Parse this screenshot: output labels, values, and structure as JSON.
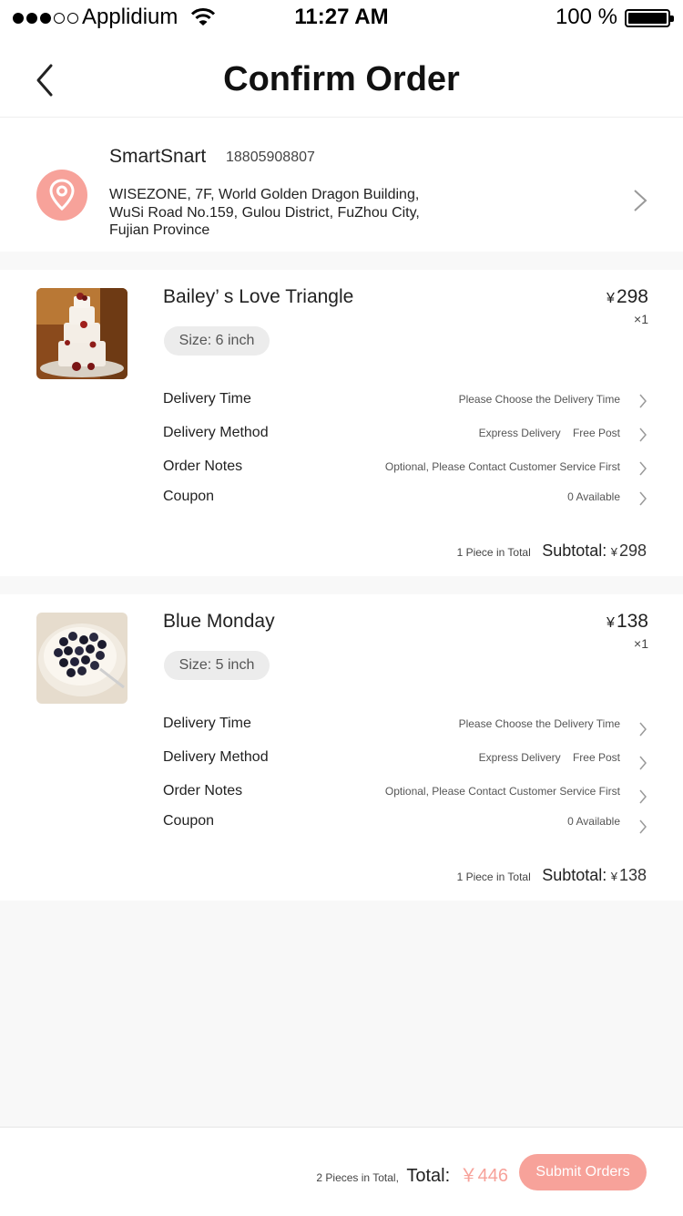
{
  "status_bar": {
    "carrier": "Applidium",
    "time": "11:27 AM",
    "battery": "100 %"
  },
  "nav": {
    "title": "Confirm Order",
    "back_icon": "chevron-left-icon"
  },
  "address": {
    "name": "SmartSnart",
    "phone": "18805908807",
    "line": "WISEZONE, 7F, World Golden Dragon Building, WuSi Road No.159, Gulou District, FuZhou City, Fujian Province",
    "icon": "location-pin-icon",
    "accent": "#f7a29a"
  },
  "items": [
    {
      "name": "Bailey’ s Love Triangle",
      "currency": "¥",
      "price": "298",
      "qty": "×1",
      "size": "Size: 6 inch",
      "options": [
        {
          "label": "Delivery Time",
          "value": "Please Choose the Delivery Time"
        },
        {
          "label": "Delivery Method",
          "value": "Express Delivery    Free Post"
        },
        {
          "label": "Order Notes",
          "value": "Optional, Please Contact Customer Service First"
        },
        {
          "label": "Coupon",
          "value": "0 Available"
        }
      ],
      "pieces": "1 Piece in Total",
      "subtotal_label": "Subtotal:",
      "subtotal": "298"
    },
    {
      "name": "Blue Monday",
      "currency": "¥",
      "price": "138",
      "qty": "×1",
      "size": "Size: 5 inch",
      "options": [
        {
          "label": "Delivery Time",
          "value": "Please Choose the Delivery Time"
        },
        {
          "label": "Delivery Method",
          "value": "Express Delivery    Free Post"
        },
        {
          "label": "Order Notes",
          "value": "Optional, Please Contact Customer Service First"
        },
        {
          "label": "Coupon",
          "value": "0 Available"
        }
      ],
      "pieces": "1 Piece in Total",
      "subtotal_label": "Subtotal:",
      "subtotal": "138"
    }
  ],
  "footer": {
    "pieces": "2 Pieces in Total,",
    "total_label": "Total:",
    "total": "￥446",
    "submit_label": "Submit Orders",
    "accent": "#f7a29a"
  }
}
